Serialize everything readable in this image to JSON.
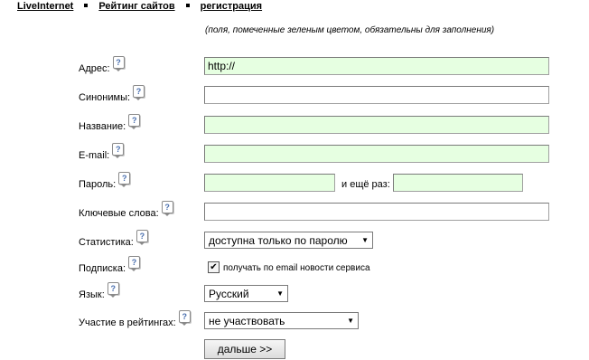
{
  "nav": {
    "home": "LiveInternet",
    "rating": "Рейтинг сайтов",
    "register": "регистрация"
  },
  "hint": "(поля, помеченные зеленым цветом, обязательны для заполнения)",
  "form": {
    "address_label": "Адрес:",
    "address_value": "http://",
    "synonyms_label": "Синонимы:",
    "name_label": "Название:",
    "email_label": "E-mail:",
    "password_label": "Пароль:",
    "password_again_label": "и ещё раз:",
    "keywords_label": "Ключевые слова:",
    "stats_label": "Статистика:",
    "stats_value": "доступна только по паролю",
    "subscription_label": "Подписка:",
    "subscription_checked": true,
    "subscription_text": "получать по email новости сервиса",
    "language_label": "Язык:",
    "language_value": "Русский",
    "ratings_label": "Участие в рейтингах:",
    "ratings_value": "не участвовать",
    "submit_label": "дальше >>"
  },
  "icons": {
    "help": "question-mark-icon",
    "checkmark": "✔",
    "help_glyph": "?",
    "dropdown": "▼"
  },
  "colors": {
    "required_field_bg": "#e6ffe1"
  }
}
